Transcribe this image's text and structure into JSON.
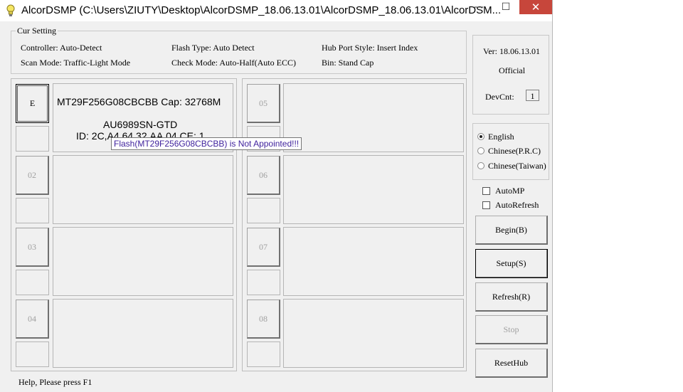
{
  "window": {
    "title": "AlcorDSMP (C:\\Users\\ZIUTY\\Desktop\\AlcorDSMP_18.06.13.01\\AlcorDSMP_18.06.13.01\\AlcorDSM...",
    "minimize_glyph": "—",
    "maximize_glyph": "☐",
    "close_glyph": "✕",
    "close_color": "#c7463b"
  },
  "cur_setting": {
    "label": "Cur Setting",
    "controller": "Controller: Auto-Detect",
    "flash_type": "Flash Type: Auto Detect",
    "hub_port_style": "Hub Port Style: Insert Index",
    "scan_mode": "Scan Mode: Traffic-Light Mode",
    "check_mode": "Check Mode: Auto-Half(Auto ECC)",
    "bin": "Bin: Stand Cap"
  },
  "version_box": {
    "version": "Ver: 18.06.13.01",
    "edition": "Official",
    "devcnt_label": "DevCnt:",
    "devcnt_value": "1"
  },
  "slots": [
    {
      "label": "E",
      "active": true,
      "line1": "MT29F256G08CBCBB Cap: 32768M",
      "line2": "AU6989SN-GTD",
      "line3": "ID: 2C,A4,64,32,AA,04  CE: 1"
    },
    {
      "label": "02"
    },
    {
      "label": "03"
    },
    {
      "label": "04"
    },
    {
      "label": "05"
    },
    {
      "label": "06"
    },
    {
      "label": "07"
    },
    {
      "label": "08"
    }
  ],
  "tooltip": "Flash(MT29F256G08CBCBB) is Not Appointed!!!",
  "language": {
    "options": [
      "English",
      "Chinese(P.R.C)",
      "Chinese(Taiwan)"
    ],
    "selected": "English"
  },
  "options": {
    "automp": {
      "label": "AutoMP",
      "checked": false
    },
    "autorefresh": {
      "label": "AutoRefresh",
      "checked": false
    }
  },
  "buttons": {
    "begin": "Begin(B)",
    "setup": "Setup(S)",
    "refresh": "Refresh(R)",
    "stop": "Stop",
    "resethub": "ResetHub"
  },
  "status_bar": "Help, Please press F1"
}
